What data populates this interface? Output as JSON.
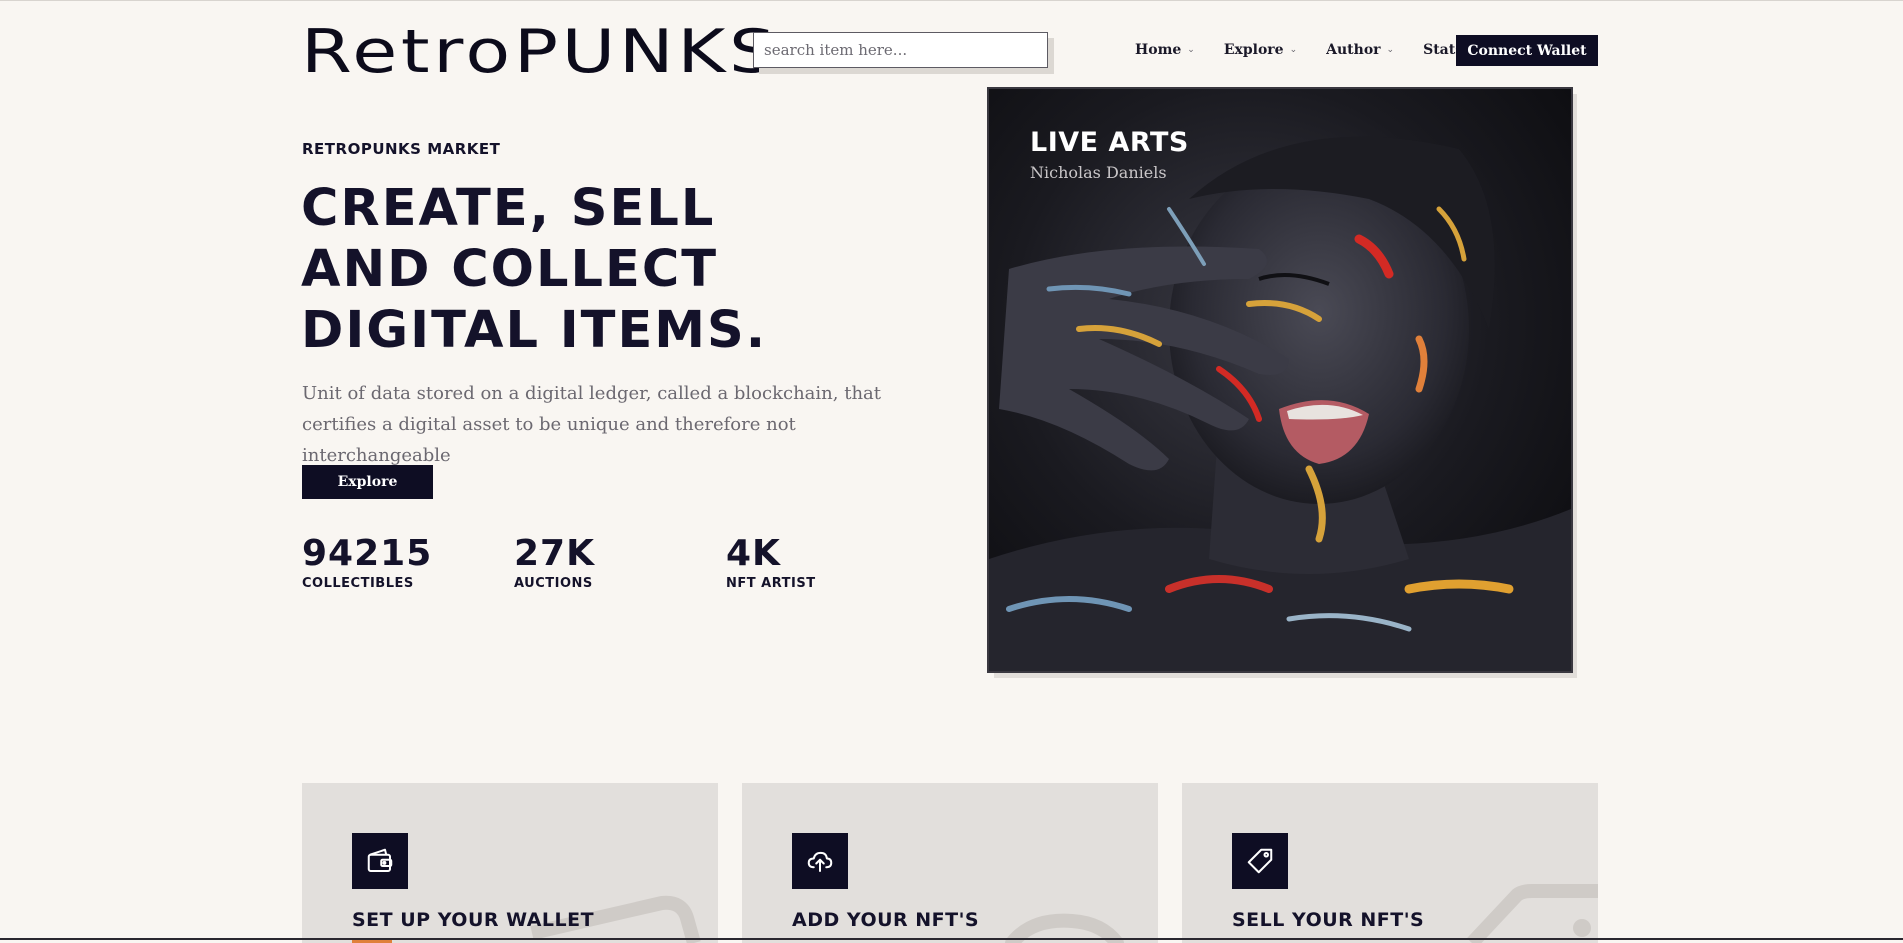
{
  "header": {
    "logo": "RetroPUNKS",
    "search_placeholder": "search item here...",
    "nav": [
      {
        "label": "Home"
      },
      {
        "label": "Explore"
      },
      {
        "label": "Author"
      },
      {
        "label": "Stats"
      }
    ],
    "connect_label": "Connect Wallet"
  },
  "hero": {
    "eyebrow": "RETROPUNKS MARKET",
    "headline": "CREATE, SELL AND COLLECT DIGITAL ITEMS.",
    "description": "Unit of data stored on a digital ledger, called a blockchain, that certifies a digital asset to be unique and therefore not interchangeable",
    "explore_label": "Explore",
    "stats": [
      {
        "value": "94215",
        "label": "COLLECTIBLES"
      },
      {
        "value": "27K",
        "label": "AUCTIONS"
      },
      {
        "value": "4K",
        "label": "NFT ARTIST"
      }
    ]
  },
  "featured": {
    "title": "LIVE ARTS",
    "author": "Nicholas Daniels"
  },
  "features": [
    {
      "title": "SET UP YOUR WALLET",
      "icon": "wallet-icon"
    },
    {
      "title": "ADD YOUR NFT'S",
      "icon": "cloud-upload-icon"
    },
    {
      "title": "SELL YOUR NFT'S",
      "icon": "tag-icon"
    }
  ],
  "colors": {
    "background": "#f9f6f2",
    "primary_dark": "#0e0d23",
    "card_bg": "#e2dfdc",
    "accent": "#e0803a"
  }
}
